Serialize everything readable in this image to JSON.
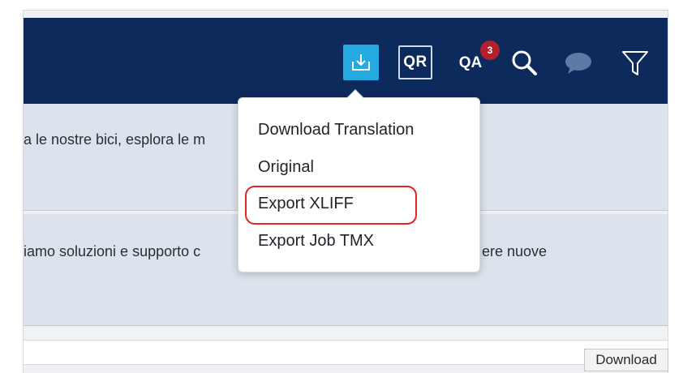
{
  "toolbar": {
    "download_icon": "download-icon",
    "qr_label": "QR",
    "qa_label": "QA",
    "qa_badge_count": "3",
    "search_icon": "search-icon",
    "chat_icon": "chat-icon",
    "filter_icon": "filter-icon",
    "colors": {
      "bar_bg": "#0d2a5c",
      "download_bg": "#26a9e1",
      "badge_bg": "#b3202c"
    }
  },
  "segments": [
    {
      "text": "a le nostre bici, esplora le m"
    },
    {
      "text": "iamo soluzioni e supporto c",
      "text_right": "ere nuove"
    }
  ],
  "download_menu": {
    "items": [
      {
        "label": "Download Translation"
      },
      {
        "label": "Original"
      },
      {
        "label": "Export XLIFF",
        "highlighted": true
      },
      {
        "label": "Export Job TMX"
      }
    ],
    "highlight_color": "#e02424"
  },
  "tooltip": {
    "label": "Download"
  }
}
